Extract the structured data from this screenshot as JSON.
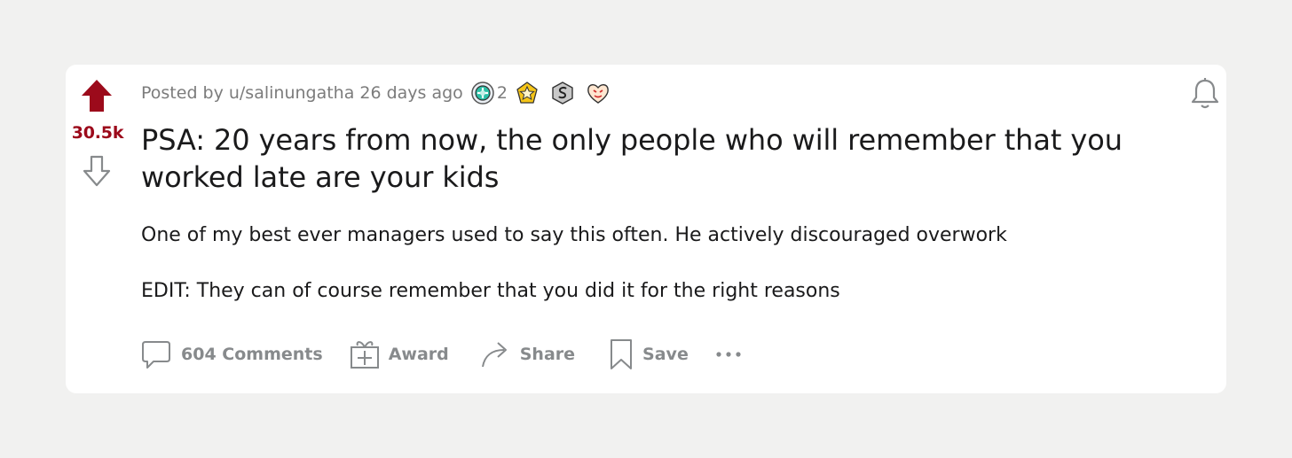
{
  "post": {
    "score": "30.5k",
    "posted_by_prefix": "Posted by",
    "username": "u/salinungatha",
    "time_ago": "26 days ago",
    "awards": [
      {
        "icon": "helpful-award-icon",
        "count": "2"
      },
      {
        "icon": "wholesome-award-icon"
      },
      {
        "icon": "silver-award-icon"
      },
      {
        "icon": "heart-award-icon"
      }
    ],
    "title": "PSA: 20 years from now, the only people who will remember that you worked late are your kids",
    "body": [
      "One of my best ever managers used to say this often. He actively discouraged overwork",
      "EDIT: They can of course remember that you did it for the right reasons"
    ]
  },
  "actions": {
    "comments_label": "604 Comments",
    "award_label": "Award",
    "share_label": "Share",
    "save_label": "Save"
  },
  "colors": {
    "background": "#f1f1f0",
    "card": "#ffffff",
    "upvoted": "#9c0a1b",
    "muted": "#878a8c",
    "text": "#1a1a1b"
  }
}
